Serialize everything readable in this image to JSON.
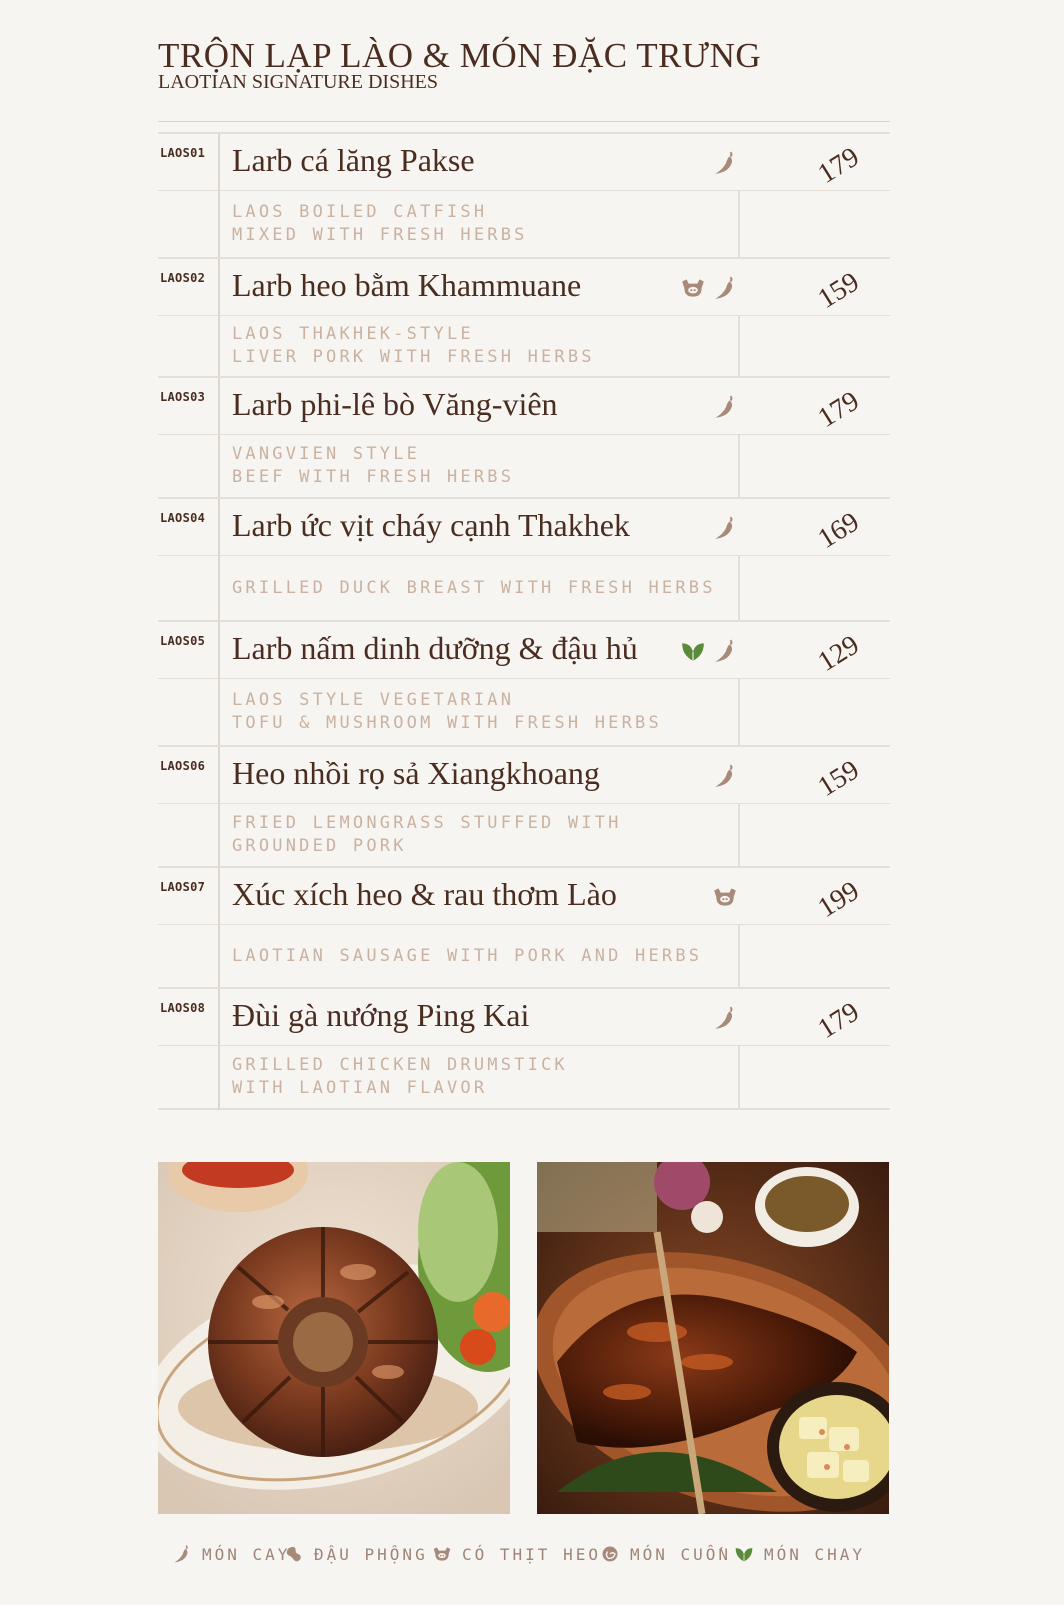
{
  "header": {
    "title_vn": "TRỘN LẠP LÀO & MÓN ĐẶC TRƯNG",
    "title_en": "LAOTIAN SIGNATURE DISHES"
  },
  "items": [
    {
      "code": "LAOS01",
      "name": "Larb cá lăng Pakse",
      "desc": [
        "LAOS BOILED CATFISH",
        "MIXED WITH FRESH HERBS"
      ],
      "price": "179",
      "icons": [
        "chili-icon"
      ]
    },
    {
      "code": "LAOS02",
      "name": "Larb heo bằm Khammuane",
      "desc": [
        "LAOS THAKHEK-STYLE",
        "LIVER PORK WITH FRESH HERBS"
      ],
      "price": "159",
      "icons": [
        "pig-icon",
        "chili-icon"
      ]
    },
    {
      "code": "LAOS03",
      "name": "Larb phi-lê bò Văng-viên",
      "desc": [
        "VANGVIEN STYLE",
        "BEEF WITH FRESH HERBS"
      ],
      "price": "179",
      "icons": [
        "chili-icon"
      ]
    },
    {
      "code": "LAOS04",
      "name": "Larb ức vịt cháy cạnh Thakhek",
      "desc": [
        "GRILLED DUCK BREAST WITH FRESH HERBS"
      ],
      "price": "169",
      "icons": [
        "chili-icon"
      ]
    },
    {
      "code": "LAOS05",
      "name": "Larb nấm dinh dưỡng & đậu hủ",
      "desc": [
        "LAOS STYLE VEGETARIAN",
        "TOFU & MUSHROOM WITH FRESH HERBS"
      ],
      "price": "129",
      "icons": [
        "leaf-icon",
        "chili-icon"
      ]
    },
    {
      "code": "LAOS06",
      "name": "Heo nhồi rọ sả Xiangkhoang",
      "desc": [
        "FRIED LEMONGRASS STUFFED WITH",
        "GROUNDED PORK"
      ],
      "price": "159",
      "icons": [
        "chili-icon"
      ]
    },
    {
      "code": "LAOS07",
      "name": "Xúc xích heo & rau thơm Lào",
      "desc": [
        "LAOTIAN SAUSAGE WITH PORK AND HERBS"
      ],
      "price": "199",
      "icons": [
        "pig-icon"
      ]
    },
    {
      "code": "LAOS08",
      "name": "Đùi gà nướng Ping Kai",
      "desc": [
        "GRILLED CHICKEN DRUMSTICK",
        "WITH LAOTIAN FLAVOR"
      ],
      "price": "179",
      "icons": [
        "chili-icon"
      ]
    }
  ],
  "legend": [
    {
      "icon": "chili-icon",
      "label": "MÓN CAY"
    },
    {
      "icon": "peanut-icon",
      "label": "ĐẬU PHỘNG"
    },
    {
      "icon": "pig-icon",
      "label": "CÓ THỊT HEO"
    },
    {
      "icon": "roll-icon",
      "label": "MÓN CUỐN"
    },
    {
      "icon": "leaf-icon",
      "label": "MÓN CHAY"
    }
  ],
  "colors": {
    "background": "#f7f5f1",
    "text": "#4a2d20",
    "description": "#c9b2a1",
    "icon": "#a88a7a",
    "veg": "#5a8a3a"
  }
}
